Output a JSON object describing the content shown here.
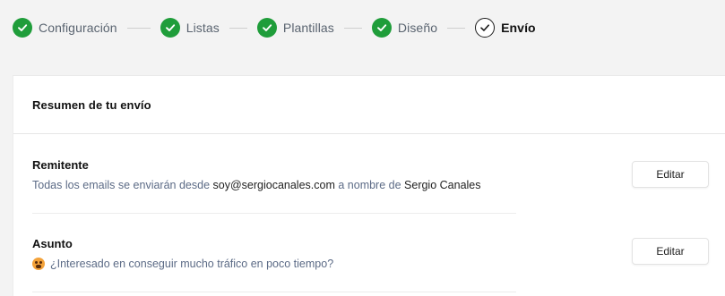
{
  "stepper": {
    "steps": [
      {
        "label": "Configuración",
        "status": "done"
      },
      {
        "label": "Listas",
        "status": "done"
      },
      {
        "label": "Plantillas",
        "status": "done"
      },
      {
        "label": "Diseño",
        "status": "done"
      },
      {
        "label": "Envío",
        "status": "current"
      }
    ],
    "colors": {
      "done": "#1f9d3a",
      "current_border": "#1a1a1a"
    }
  },
  "summary": {
    "title": "Resumen de tu envío",
    "sender": {
      "title": "Remitente",
      "desc_prefix": "Todas los emails se enviarán desde",
      "email": "soy@sergiocanales.com",
      "desc_middle": "a nombre de",
      "name": "Sergio Canales",
      "edit_label": "Editar"
    },
    "subject": {
      "title": "Asunto",
      "emoji_icon": "worried-face-emoji-icon",
      "text": "¿Interesado en conseguir mucho tráfico en poco tiempo?",
      "edit_label": "Editar"
    }
  }
}
